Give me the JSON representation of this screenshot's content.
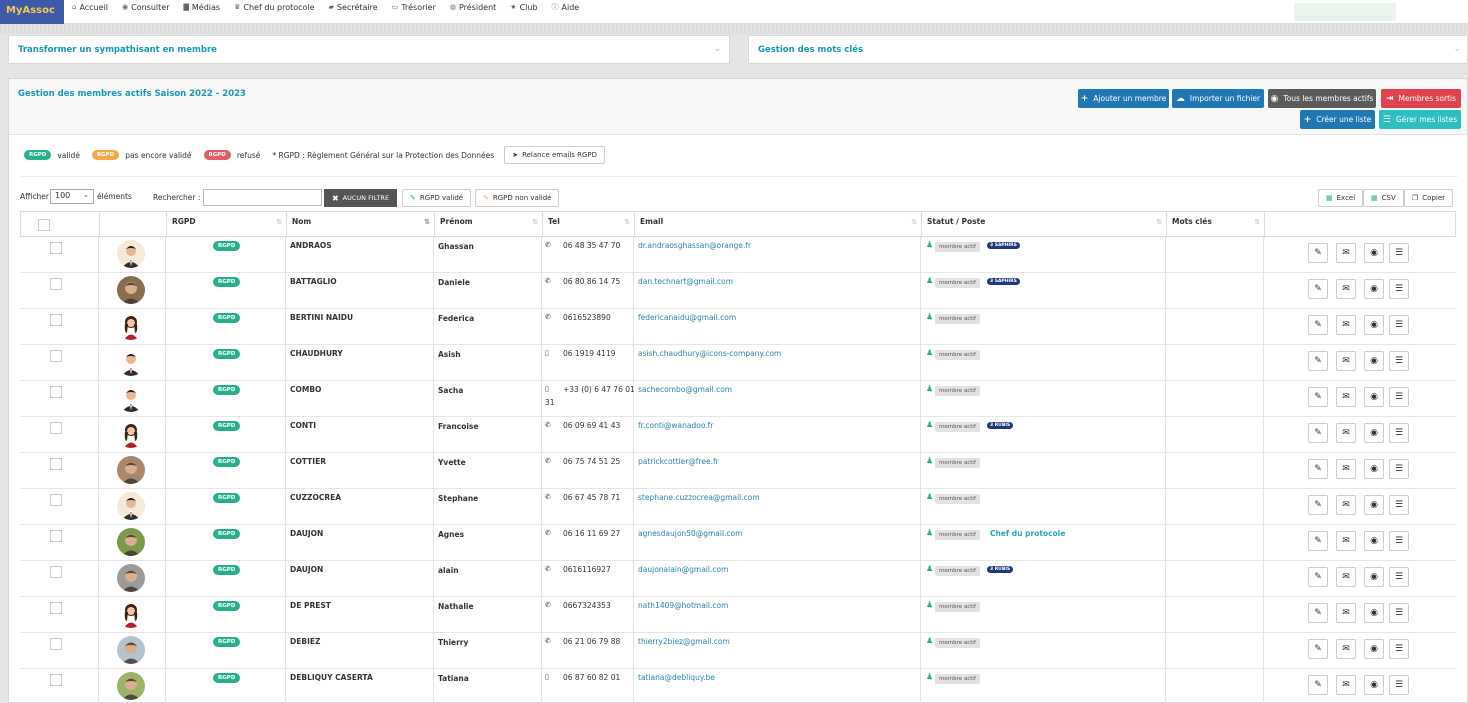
{
  "app": {
    "name": "MyAssoc"
  },
  "nav": [
    {
      "icon": "home-icon",
      "glyph": "⌂",
      "label": "Accueil"
    },
    {
      "icon": "eye-icon",
      "glyph": "◉",
      "label": "Consulter"
    },
    {
      "icon": "file-icon",
      "glyph": "▇",
      "label": "Médias"
    },
    {
      "icon": "trophy-icon",
      "glyph": "♛",
      "label": "Chef du protocole"
    },
    {
      "icon": "book-icon",
      "glyph": "▰",
      "label": "Secrétaire"
    },
    {
      "icon": "money-icon",
      "glyph": "▭",
      "label": "Trésorier"
    },
    {
      "icon": "globe-icon",
      "glyph": "◍",
      "label": "Président"
    },
    {
      "icon": "star-icon",
      "glyph": "★",
      "label": "Club"
    },
    {
      "icon": "info-icon",
      "glyph": "ⓘ",
      "label": "Aide"
    }
  ],
  "panels": {
    "transform": "Transformer un sympathisant en membre",
    "keywords": "Gestion des mots clés"
  },
  "main": {
    "title": "Gestion des membres actifs Saison 2022 - 2023",
    "buttons": {
      "add": "Ajouter un membre",
      "import": "Importer un fichier",
      "all": "Tous les membres actifs",
      "out": "Membres sortis",
      "create_list": "Créer une liste",
      "manage_lists": "Gérer mes listes"
    }
  },
  "legend": {
    "badge": "RGPD",
    "validated": "validé",
    "pending": "pas encore validé",
    "refused": "refusé",
    "note": "* RGPD : Règlement Général sur la Protection des Données",
    "relaunch": "Relance emails RGPD"
  },
  "controls": {
    "show": "Afficher",
    "page_size": "100",
    "elements": "éléments",
    "search": "Rechercher :",
    "no_filter": "AUCUN FILTRE",
    "rgpd_ok": "RGPD validé",
    "rgpd_ko": "RGPD non validé",
    "excel": "Excel",
    "csv": "CSV",
    "copy": "Copier"
  },
  "columns": {
    "rgpd": "RGPD",
    "nom": "Nom",
    "prenom": "Prénom",
    "tel": "Tel",
    "email": "Email",
    "statut": "Statut / Poste",
    "mots": "Mots clés"
  },
  "status_label": "membre actif",
  "rows": [
    {
      "nom": "ANDRAOS",
      "prenom": "Ghassan",
      "phone_icon": "phone-icon",
      "tel": "06 48 35 47 70",
      "tel_line2": "",
      "email": "dr.andraosghassan@orange.fr",
      "avatar": "male-dark",
      "extra": "3 SAPHIRS",
      "extra_type": "badge"
    },
    {
      "nom": "BATTAGLIO",
      "prenom": "Daniele",
      "phone_icon": "phone-icon",
      "tel": "06 80 86 14 75",
      "tel_line2": "",
      "email": "dan.technart@gmail.com",
      "avatar": "male-photo",
      "extra": "3 SAPHIRS",
      "extra_type": "badge"
    },
    {
      "nom": "BERTINI NAIDU",
      "prenom": "Federica",
      "phone_icon": "phone-icon",
      "tel": "0616523890",
      "tel_line2": "",
      "email": "federicanaidu@gmail.com",
      "avatar": "female",
      "extra": "",
      "extra_type": ""
    },
    {
      "nom": "CHAUDHURY",
      "prenom": "Asish",
      "phone_icon": "mobile-icon",
      "tel": "06 1919 4119",
      "tel_line2": "",
      "email": "asish.chaudhury@icons-company.com",
      "avatar": "male",
      "extra": "",
      "extra_type": ""
    },
    {
      "nom": "COMBO",
      "prenom": "Sacha",
      "phone_icon": "mobile-icon",
      "tel": "+33 (0) 6 47 76 01",
      "tel_line2": "31",
      "email": "sachecombo@gmail.com",
      "avatar": "male",
      "extra": "",
      "extra_type": ""
    },
    {
      "nom": "CONTI",
      "prenom": "Francoise",
      "phone_icon": "phone-icon",
      "tel": "06 09 69 41 43",
      "tel_line2": "",
      "email": "fr.conti@wanadoo.fr",
      "avatar": "female",
      "extra": "3 RUBIS",
      "extra_type": "badge"
    },
    {
      "nom": "COTTIER",
      "prenom": "Yvette",
      "phone_icon": "phone-icon",
      "tel": "06 75 74 51 25",
      "tel_line2": "",
      "email": "patrickcottier@free.fr",
      "avatar": "photo-warm",
      "extra": "",
      "extra_type": ""
    },
    {
      "nom": "CUZZOCREA",
      "prenom": "Stephane",
      "phone_icon": "phone-icon",
      "tel": "06 67 45 78 71",
      "tel_line2": "",
      "email": "stephane.cuzzocrea@gmail.com",
      "avatar": "male-dark",
      "extra": "",
      "extra_type": ""
    },
    {
      "nom": "DAUJON",
      "prenom": "Agnes",
      "phone_icon": "phone-icon",
      "tel": "06 16 11 69 27",
      "tel_line2": "",
      "email": "agnesdaujon50@gmail.com",
      "avatar": "photo-green",
      "extra": "Chef du protocole",
      "extra_type": "text"
    },
    {
      "nom": "DAUJON",
      "prenom": "alain",
      "phone_icon": "phone-icon",
      "tel": "0616116927",
      "tel_line2": "",
      "email": "daujonalain@gmail.com",
      "avatar": "photo-grey",
      "extra": "3 RUBIS",
      "extra_type": "badge"
    },
    {
      "nom": "DE PREST",
      "prenom": "Nathalie",
      "phone_icon": "phone-icon",
      "tel": "0667324353",
      "tel_line2": "",
      "email": "nath1409@hotmail.com",
      "avatar": "female",
      "extra": "",
      "extra_type": ""
    },
    {
      "nom": "DEBIEZ",
      "prenom": "Thierry",
      "phone_icon": "phone-icon",
      "tel": "06 21 06 79 88",
      "tel_line2": "",
      "email": "thierry2biez@gmail.com",
      "avatar": "photo-light",
      "extra": "",
      "extra_type": ""
    },
    {
      "nom": "DEBLIQUY CASERTA",
      "prenom": "Tatiana",
      "phone_icon": "mobile-icon",
      "tel": "06 87 60 82 01",
      "tel_line2": "",
      "email": "tatiana@debliquy.be",
      "avatar": "photo-outdoor",
      "extra": "",
      "extra_type": ""
    }
  ],
  "row_actions": [
    {
      "icon": "edit-icon",
      "glyph": "✎"
    },
    {
      "icon": "mail-icon",
      "glyph": "✉"
    },
    {
      "icon": "eye-icon",
      "glyph": "◉"
    },
    {
      "icon": "list-icon",
      "glyph": "☰"
    }
  ]
}
